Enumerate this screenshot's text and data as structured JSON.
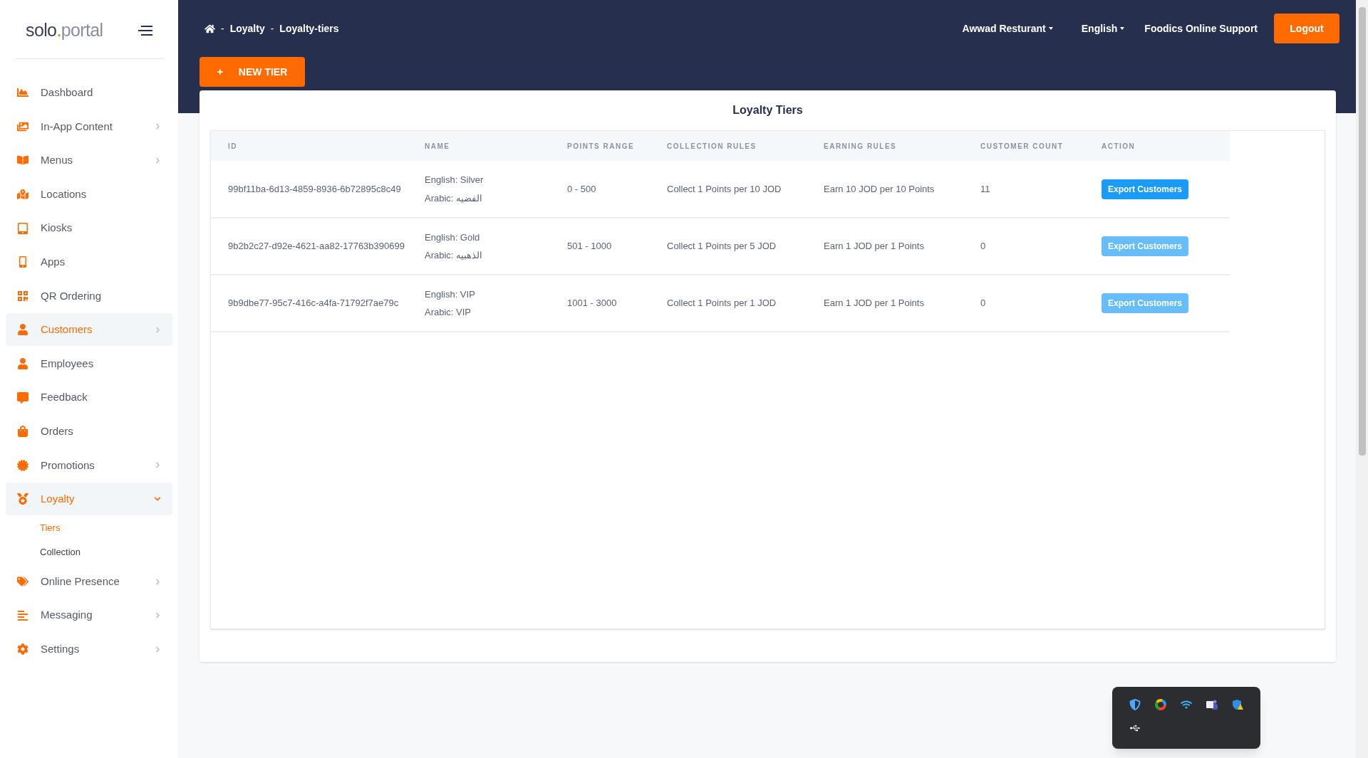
{
  "sidebar": {
    "logo_left": "solo",
    "logo_dot": ".",
    "logo_right": "portal",
    "items": [
      {
        "label": "Dashboard",
        "selected": false,
        "has_submenu": false
      },
      {
        "label": "In-App Content",
        "selected": false,
        "has_submenu": true
      },
      {
        "label": "Menus",
        "selected": false,
        "has_submenu": true
      },
      {
        "label": "Locations",
        "selected": false,
        "has_submenu": false
      },
      {
        "label": "Kiosks",
        "selected": false,
        "has_submenu": false
      },
      {
        "label": "Apps",
        "selected": false,
        "has_submenu": false
      },
      {
        "label": "QR Ordering",
        "selected": false,
        "has_submenu": false
      },
      {
        "label": "Customers",
        "selected": true,
        "has_submenu": true
      },
      {
        "label": "Employees",
        "selected": false,
        "has_submenu": false
      },
      {
        "label": "Feedback",
        "selected": false,
        "has_submenu": false
      },
      {
        "label": "Orders",
        "selected": false,
        "has_submenu": false
      },
      {
        "label": "Promotions",
        "selected": false,
        "has_submenu": true
      },
      {
        "label": "Loyalty",
        "selected": true,
        "has_submenu": true,
        "expanded": true,
        "children": [
          {
            "label": "Tiers",
            "selected": true
          },
          {
            "label": "Collection",
            "selected": false
          }
        ]
      },
      {
        "label": "Online Presence",
        "selected": false,
        "has_submenu": true
      },
      {
        "label": "Messaging",
        "selected": false,
        "has_submenu": true
      },
      {
        "label": "Settings",
        "selected": false,
        "has_submenu": true
      }
    ]
  },
  "breadcrumb": [
    {
      "label": "Loyalty",
      "separator": "-"
    },
    {
      "label": "Loyalty-tiers",
      "separator": "-"
    }
  ],
  "topbar": {
    "restaurant": "Awwad Resturant",
    "language": "English",
    "support": "Foodics Online Support",
    "logout": "Logout"
  },
  "new_button": {
    "icon": "+",
    "label": "NEW TIER"
  },
  "card": {
    "title": "Loyalty Tiers"
  },
  "table": {
    "columns": [
      "ID",
      "NAME",
      "POINTS RANGE",
      "COLLECTION RULES",
      "EARNING RULES",
      "CUSTOMER COUNT",
      "ACTION"
    ],
    "rows": [
      {
        "id": "99bf11ba-6d13-4859-8936-6b72895c8c49",
        "name_en": "English: Silver",
        "name_ar": "Arabic: الفضيه",
        "range": "0 - 500",
        "collection": "Collect 1 Points per 10 JOD",
        "earning": "Earn 10 JOD per 10 Points",
        "count": "11",
        "action": "Export Customers",
        "disabled": false
      },
      {
        "id": "9b2b2c27-d92e-4621-aa82-17763b390699",
        "name_en": "English: Gold",
        "name_ar": "Arabic: الذهبيه",
        "range": "501 - 1000",
        "collection": "Collect 1 Points per 5 JOD",
        "earning": "Earn 1 JOD per 1 Points",
        "count": "0",
        "action": "Export Customers",
        "disabled": true
      },
      {
        "id": "9b9dbe77-95c7-416c-a4fa-71792f7ae79c",
        "name_en": "English: VIP",
        "name_ar": "Arabic: VIP",
        "range": "1001 - 3000",
        "collection": "Collect 1 Points per 1 JOD",
        "earning": "Earn 1 JOD per 1 Points",
        "count": "0",
        "action": "Export Customers",
        "disabled": true
      }
    ]
  }
}
